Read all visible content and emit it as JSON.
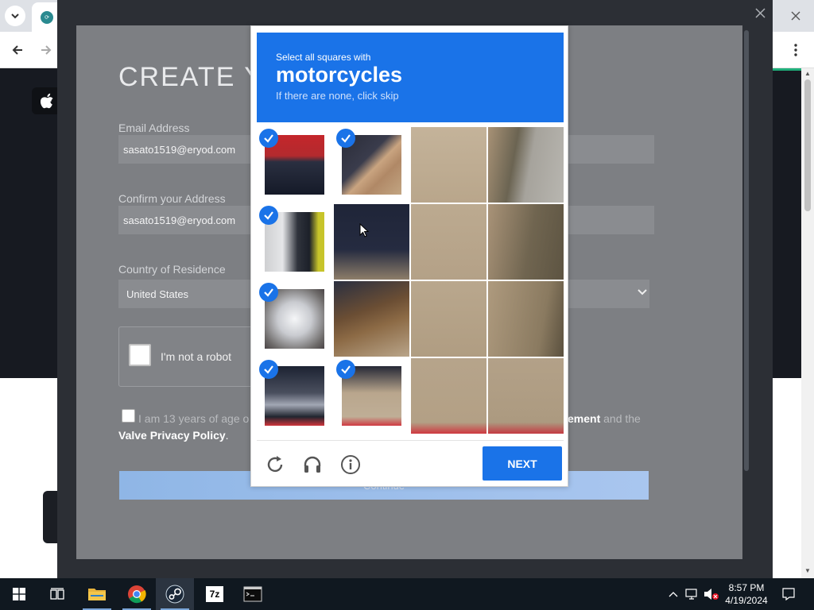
{
  "steam_form": {
    "title": "CREATE Y",
    "email_label": "Email Address",
    "email_value": "sasato1519@eryod.com",
    "confirm_label": "Confirm your Address",
    "confirm_value": "sasato1519@eryod.com",
    "country_label": "Country of Residence",
    "country_value": "United States",
    "recaptcha_label": "I'm not a robot",
    "age_text_left": "I am 13 years of age o",
    "age_text_bold": "ement",
    "age_text_right": " and the",
    "privacy_link": "Valve Privacy Policy",
    "privacy_suffix": ".",
    "continue_label": "Continue"
  },
  "captcha": {
    "instruction": "Select all squares with",
    "target": "motorcycles",
    "hint": "If there are none, click skip",
    "next_label": "NEXT",
    "icons": [
      "reload-icon",
      "audio-icon",
      "info-icon"
    ],
    "accent": "#1a73e8",
    "tiles_selected": [
      [
        true,
        true,
        false,
        false
      ],
      [
        true,
        false,
        false,
        false
      ],
      [
        true,
        false,
        false,
        false
      ],
      [
        true,
        true,
        false,
        false
      ]
    ]
  },
  "taskbar": {
    "apps": [
      "start-icon",
      "task-view-icon",
      "file-explorer-icon",
      "chrome-icon",
      "steam-icon",
      "7zip-icon",
      "terminal-icon"
    ],
    "active_app": "steam-icon",
    "seven_zip_label": "7z",
    "time": "8:57 PM",
    "date": "4/19/2024"
  }
}
